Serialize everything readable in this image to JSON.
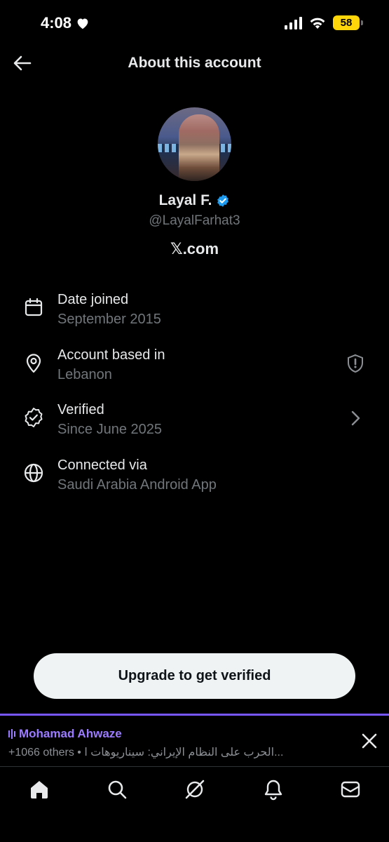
{
  "status_bar": {
    "time": "4:08",
    "battery": "58"
  },
  "header": {
    "title": "About this account"
  },
  "profile": {
    "display_name": "Layal F.",
    "handle": "@LayalFarhat3",
    "site_x": "𝕏",
    "site_domain": ".com"
  },
  "info": [
    {
      "label": "Date joined",
      "value": "September 2015",
      "icon": "calendar-icon"
    },
    {
      "label": "Account based in",
      "value": "Lebanon",
      "icon": "location-pin-icon"
    },
    {
      "label": "Verified",
      "value": "Since June 2025",
      "icon": "verified-badge-icon"
    },
    {
      "label": "Connected via",
      "value": "Saudi Arabia Android App",
      "icon": "globe-icon"
    }
  ],
  "upgrade_button": {
    "label": "Upgrade to get verified"
  },
  "live_banner": {
    "name": "Mohamad Ahwaze",
    "subtitle": "+1066 others • الحرب على النظام الإيراني: سيناريوهات ا..."
  },
  "bottom_nav": [
    "home-icon",
    "search-icon",
    "grok-icon",
    "notifications-icon",
    "messages-icon"
  ],
  "colors": {
    "accent": "#1d9bf0",
    "live": "#9b7bff",
    "battery": "#ffd60a"
  }
}
